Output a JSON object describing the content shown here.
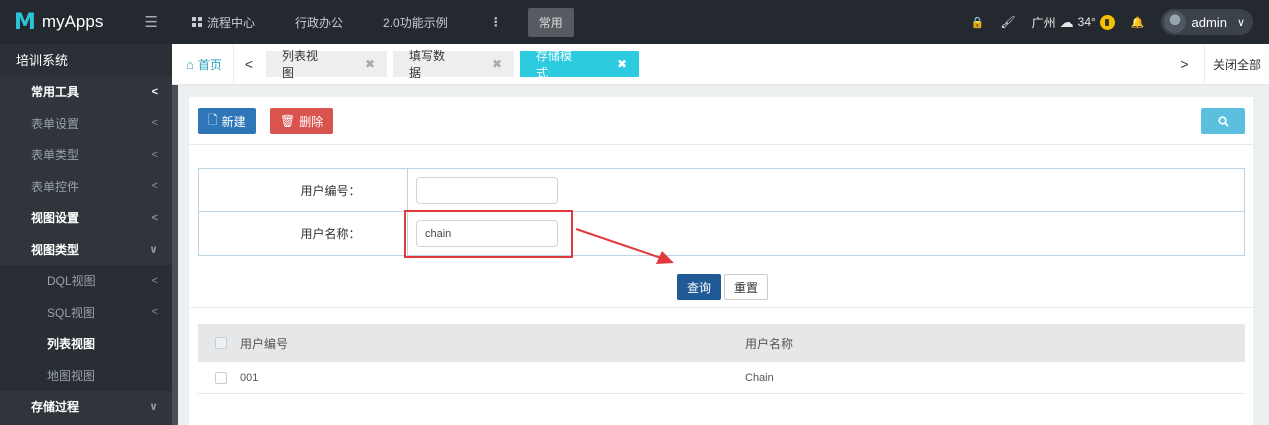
{
  "brand": {
    "logo_letter": "M",
    "name": "myApps",
    "menu_toggle_icon": "indent-icon"
  },
  "topnav": {
    "items": [
      {
        "label": "流程中心",
        "icon": "grid-icon"
      },
      {
        "label": "行政办公"
      },
      {
        "label": "2.0功能示例"
      }
    ],
    "more": "⋮",
    "common": "常用"
  },
  "topright": {
    "lock_icon": "🔒",
    "brush_icon": "🖌",
    "city": "广州",
    "cloud_icon": "☁",
    "temperature": "34°",
    "bell_icon": "🔔",
    "user": "admin",
    "user_chevron": "∨"
  },
  "sidebar": {
    "root": "培训系统",
    "items": [
      {
        "label": "常用工具",
        "bold": true,
        "chev": "<"
      },
      {
        "label": "表单设置",
        "chev": "<"
      },
      {
        "label": "表单类型",
        "chev": "<"
      },
      {
        "label": "表单控件",
        "chev": "<"
      },
      {
        "label": "视图设置",
        "bold": true,
        "chev": "<"
      },
      {
        "label": "视图类型",
        "bold": true,
        "chev": "∨"
      },
      {
        "label": "DQL视图",
        "sub": true,
        "chev": "<"
      },
      {
        "label": "SQL视图",
        "sub": true,
        "chev": "<"
      },
      {
        "label": "列表视图",
        "sub": true,
        "active": true
      },
      {
        "label": "地图视图",
        "sub": true
      },
      {
        "label": "存储过程",
        "bold": true,
        "chev": "∨"
      }
    ]
  },
  "tabs": {
    "home": "首页",
    "prev": "<",
    "next": ">",
    "items": [
      {
        "label": "列表视图",
        "close": "✖"
      },
      {
        "label": "填写数据",
        "close": "✖"
      },
      {
        "label": "存储模式",
        "close": "✖",
        "active": true
      }
    ],
    "close_all": "关闭全部"
  },
  "toolbar": {
    "new_label": "新建",
    "delete_label": "删除"
  },
  "form": {
    "user_code_label": "用户编号：",
    "user_code_value": "",
    "user_name_label": "用户名称：",
    "user_name_value": "chain"
  },
  "query": {
    "search_label": "查询",
    "reset_label": "重置"
  },
  "table": {
    "headers": [
      "用户编号",
      "用户名称"
    ],
    "rows": [
      [
        "001",
        "Chain"
      ]
    ]
  },
  "colors": {
    "accent": "#2ccbe0",
    "primary": "#2f76b8",
    "danger": "#d9534f",
    "highlight": "#e4393c"
  }
}
